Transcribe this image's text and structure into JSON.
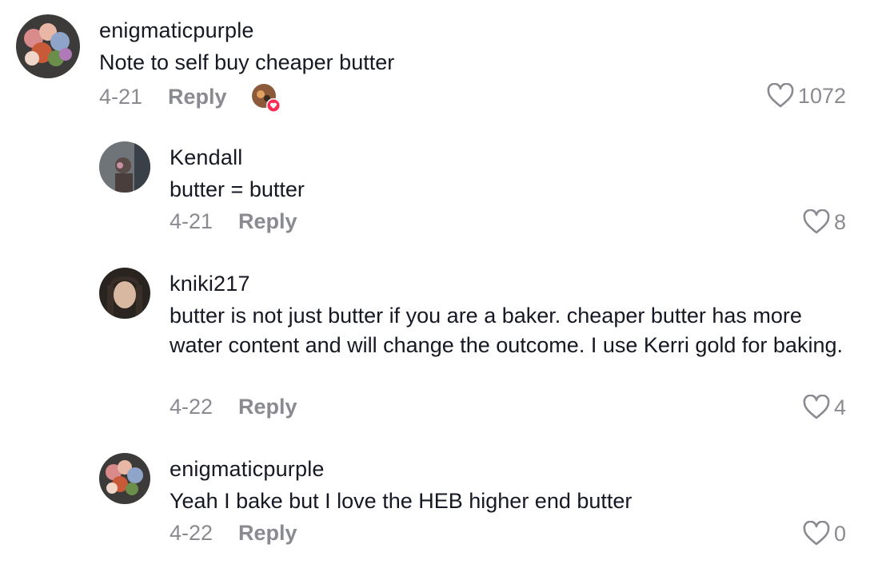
{
  "comments": [
    {
      "username": "enigmaticpurple",
      "text": "Note to self buy cheaper butter",
      "date": "4-21",
      "reply_label": "Reply",
      "likes": "1072",
      "liked_by_creator": true
    },
    {
      "username": "Kendall",
      "text": "butter = butter",
      "date": "4-21",
      "reply_label": "Reply",
      "likes": "8"
    },
    {
      "username": "kniki217",
      "text": "butter is not just butter if you are a baker. cheaper butter has more water content and will change the outcome. I use Kerri gold for baking.",
      "date": "4-22",
      "reply_label": "Reply",
      "likes": "4"
    },
    {
      "username": "enigmaticpurple",
      "text": "Yeah I bake but I love the HEB higher end butter",
      "date": "4-22",
      "reply_label": "Reply",
      "likes": "0"
    }
  ],
  "colors": {
    "text": "#161823",
    "muted": "#8a8b91",
    "creator_heart": "#fe2c55"
  }
}
